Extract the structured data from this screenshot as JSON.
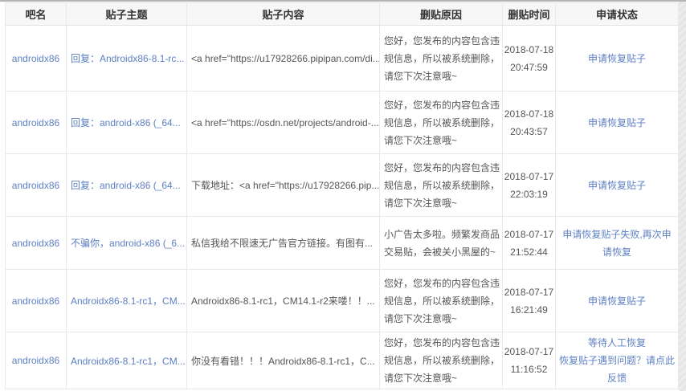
{
  "colors": {
    "link_blue": "#5d7fc4",
    "header_bg": "#f7f7f7",
    "header_text": "#333333",
    "body_text": "#565656",
    "border": "#e9e9e9",
    "top_bar": "#b4b4b4",
    "side_strip": "#e9e9e9"
  },
  "table": {
    "headers": {
      "forum": "吧名",
      "topic": "贴子主题",
      "content": "贴子内容",
      "reason": "删贴原因",
      "time": "删贴时间",
      "status": "申请状态"
    },
    "rows": [
      {
        "forum": "androidx86",
        "topic": "回复：Androidx86-8.1-rc...",
        "content": "<a href=\"https://u17928266.pipipan.com/di...",
        "reason": "您好，您发布的内容包含违规信息，所以被系统删除，请您下次注意哦~",
        "time": "2018-07-18 20:47:59",
        "status_lines": [
          "申请恢复贴子"
        ]
      },
      {
        "forum": "androidx86",
        "topic": "回复：android-x86 (_64...",
        "content": "<a href=\"https://osdn.net/projects/android-...",
        "reason": "您好，您发布的内容包含违规信息，所以被系统删除，请您下次注意哦~",
        "time": "2018-07-18 20:43:57",
        "status_lines": [
          "申请恢复贴子"
        ]
      },
      {
        "forum": "androidx86",
        "topic": "回复：android-x86 (_64...",
        "content": "下载地址：<a href=\"https://u17928266.pip...",
        "reason": "您好，您发布的内容包含违规信息，所以被系统删除，请您下次注意哦~",
        "time": "2018-07-17 22:03:19",
        "status_lines": [
          "申请恢复贴子"
        ]
      },
      {
        "forum": "androidx86",
        "topic": "不骗你，android-x86 (_6...",
        "content": "私信我给不限速无广告官方链接。有图有...",
        "reason": "小广告太多啦。频繁发商品交易贴，会被关小黑屋的~",
        "time": "2018-07-17 21:52:44",
        "status_lines": [
          "申请恢复贴子失败,再次申请恢复"
        ]
      },
      {
        "forum": "androidx86",
        "topic": "Androidx86-8.1-rc1，CM...",
        "content": "Androidx86-8.1-rc1，CM14.1-r2来喽！！...",
        "reason": "您好，您发布的内容包含违规信息，所以被系统删除，请您下次注意哦~",
        "time": "2018-07-17 16:21:49",
        "status_lines": [
          "申请恢复贴子"
        ]
      },
      {
        "forum": "androidx86",
        "topic": "Androidx86-8.1-rc1，CM...",
        "content": "你没有看错！！！Androidx86-8.1-rc1，C...",
        "reason": "您好，您发布的内容包含违规信息，所以被系统删除，请您下次注意哦~",
        "time": "2018-07-17 11:16:52",
        "status_lines": [
          "等待人工恢复",
          "恢复贴子遇到问题？请点此反馈"
        ]
      }
    ]
  }
}
